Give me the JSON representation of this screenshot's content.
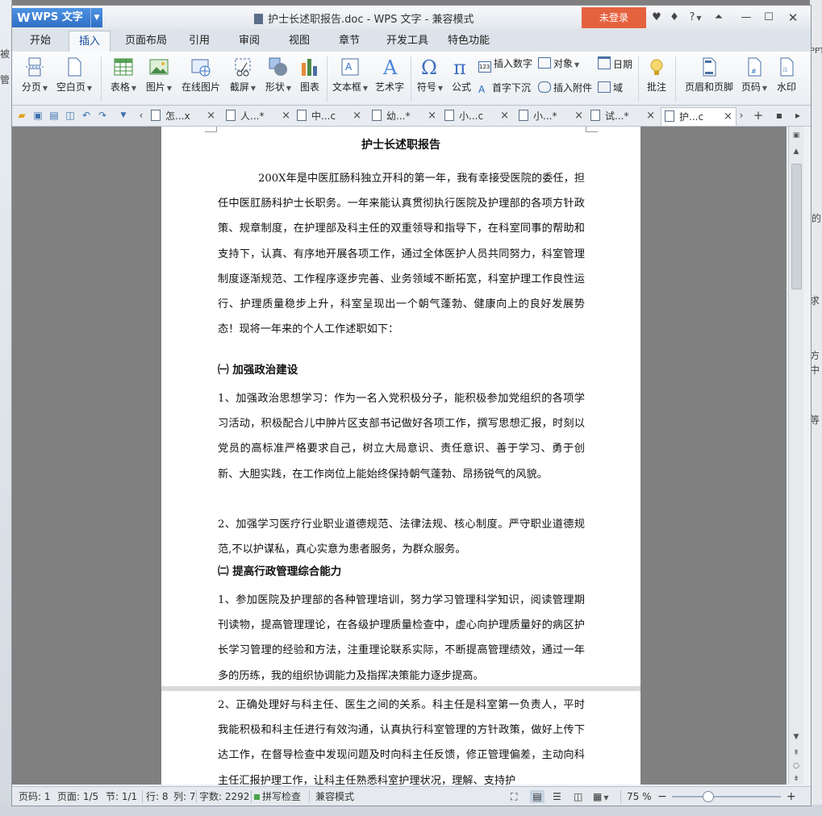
{
  "app": {
    "name": "WPS 文字",
    "logo": "W"
  },
  "window_title": "护士长述职报告.doc - WPS 文字 - 兼容模式",
  "login_label": "未登录",
  "title_icons": [
    "skin-icon",
    "shirt-icon",
    "help-icon",
    "collapse-icon",
    "minimize-icon",
    "maximize-icon",
    "close-icon"
  ],
  "help_label": "?",
  "menu_tabs": [
    "开始",
    "插入",
    "页面布局",
    "引用",
    "审阅",
    "视图",
    "章节",
    "开发工具",
    "特色功能"
  ],
  "active_tab": "插入",
  "ribbon": {
    "page_break": "分页",
    "blank_page": "空白页",
    "table": "表格",
    "picture": "图片",
    "online_picture": "在线图片",
    "screenshot": "截屏",
    "shape": "形状",
    "chart": "图表",
    "textbox": "文本框",
    "wordart": "艺术字",
    "symbol": "符号",
    "formula": "公式",
    "insert_number": "插入数字",
    "object": "对象",
    "date": "日期",
    "drop_cap": "首字下沉",
    "attachment": "插入附件",
    "field": "域",
    "comment": "批注",
    "header_footer": "页眉和页脚",
    "page_number": "页码",
    "watermark": "水印"
  },
  "doc_tabs": [
    {
      "label": "怎...x"
    },
    {
      "label": "人...*"
    },
    {
      "label": "中...c"
    },
    {
      "label": "幼...*"
    },
    {
      "label": "小...c"
    },
    {
      "label": "小...*"
    },
    {
      "label": "试...*"
    },
    {
      "label": "护...c"
    }
  ],
  "document": {
    "title": "护士长述职报告",
    "intro": "200X年是中医肛肠科独立开科的第一年，我有幸接受医院的委任，担任中医肛肠科护士长职务。一年来能认真贯彻执行医院及护理部的各项方针政策、规章制度，在护理部及科主任的双重领导和指导下，在科室同事的帮助和支持下，认真、有序地开展各项工作，通过全体医护人员共同努力，科室管理制度逐渐规范、工作程序逐步完善、业务领域不断拓宽，科室护理工作良性运行、护理质量稳步上升，科室呈现出一个朝气蓬勃、健康向上的良好发展势态！现将一年来的个人工作述职如下：",
    "section1_title": "㈠ 加强政治建设",
    "section1_p1": "1、加强政治思想学习：作为一名入党积极分子，能积极参加党组织的各项学习活动，积极配合儿中肿片区支部书记做好各项工作，撰写思想汇报，时刻以党员的高标准严格要求自己，树立大局意识、责任意识、善于学习、勇于创新、大胆实践，在工作岗位上能始终保持朝气蓬勃、昂扬锐气的风貌。",
    "section1_p2": "2、加强学习医疗行业职业道德规范、法律法规、核心制度。严守职业道德规范,不以护谋私，真心实意为患者服务，为群众服务。",
    "section2_title": "㈡ 提高行政管理综合能力",
    "section2_p1": "1、参加医院及护理部的各种管理培训，努力学习管理科学知识，阅读管理期刊读物，提高管理理论，在各级护理质量检查中，虚心向护理质量好的病区护长学习管理的经验和方法，注重理论联系实际，不断提高管理绩效，通过一年多的历练，我的组织协调能力及指挥决策能力逐步提高。",
    "section2_p2": "2、正确处理好与科主任、医生之间的关系。科主任是科室第一负责人，平时我能积极和科主任进行有效沟通，认真执行科室管理的方针政策，做好上传下达工作，在督导检查中发现问题及时向科主任反馈，修正管理偏差，主动向科主任汇报护理工作，让科主任熟悉科室护理状况，理解、支持护"
  },
  "status": {
    "page_no": "页码: 1",
    "pages": "页面: 1/5",
    "section": "节: 1/1",
    "row": "行: 8",
    "col": "列: 7",
    "word_count": "字数: 2292",
    "spell_check": "拼写检查",
    "compat_mode": "兼容模式",
    "zoom": "75 %",
    "zoom_fraction": 0.33
  },
  "background": {
    "left_texts": [
      "被",
      "管"
    ],
    "right_texts": [
      "PPT",
      "的",
      "求",
      "方",
      "中",
      "等"
    ]
  },
  "colors": {
    "accent": "#2f6fc4",
    "login": "#e5623f",
    "scroll_marker": "#3a7ed0"
  }
}
